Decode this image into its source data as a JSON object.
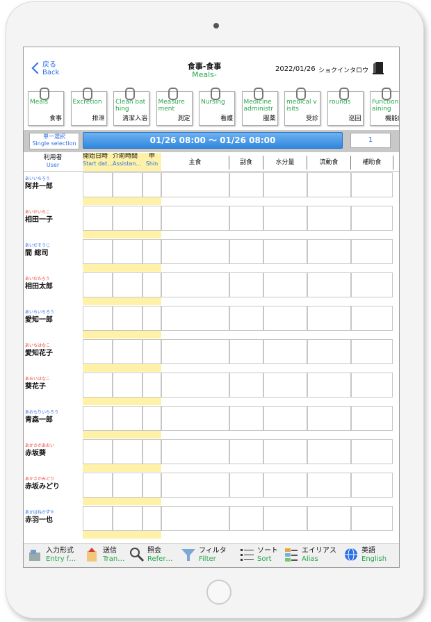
{
  "header": {
    "back_label": "戻る",
    "back_sub": "Back",
    "title": "食事-食事",
    "subtitle": "Meals-",
    "date": "2022/01/26",
    "user": "ショクインタロウ"
  },
  "tabs": [
    {
      "en": "Meals",
      "jp": "食事"
    },
    {
      "en": "Excretion",
      "jp": "排泄"
    },
    {
      "en": "Clean bathing",
      "jp": "清潔入浴"
    },
    {
      "en": "Measurement",
      "jp": "測定"
    },
    {
      "en": "Nursing",
      "jp": "看護"
    },
    {
      "en": "Medicine administra",
      "jp": "服薬"
    },
    {
      "en": "medical visits",
      "jp": "受診"
    },
    {
      "en": "rounds",
      "jp": "巡回"
    },
    {
      "en": "Function aining",
      "jp": "機能訓"
    }
  ],
  "range": {
    "select_jp": "単一選択",
    "select_en": "Single selection",
    "text": "01/26 08:00 〜 01/26 08:00",
    "page": "1"
  },
  "columns": {
    "user_jp": "利用者",
    "user_en": "User",
    "start_jp": "開始日時",
    "start_en": "Start dat…",
    "assist_jp": "介助時間",
    "assist_en": "Assistan…",
    "shin_jp": "申",
    "shin_en": "Shin",
    "main": "主食",
    "side": "副食",
    "water": "水分量",
    "liquid": "流動食",
    "supp": "補助食"
  },
  "rows": [
    {
      "kana": "あいいちろう",
      "name": "阿井一郎",
      "kana_color": "#2b6fe8"
    },
    {
      "kana": "あいだいちこ",
      "name": "相田一子",
      "kana_color": "#e8453c"
    },
    {
      "kana": "あいだそうじ",
      "name": "間 総司",
      "kana_color": "#2b6fe8"
    },
    {
      "kana": "あいだたろう",
      "name": "相田太郎",
      "kana_color": "#e8453c"
    },
    {
      "kana": "あいちいちろう",
      "name": "愛知一郎",
      "kana_color": "#2b6fe8"
    },
    {
      "kana": "あいちはなこ",
      "name": "愛知花子",
      "kana_color": "#e8453c"
    },
    {
      "kana": "あおいはなこ",
      "name": "葵花子",
      "kana_color": "#e8453c"
    },
    {
      "kana": "あおもりいちろう",
      "name": "青森一郎",
      "kana_color": "#2b6fe8"
    },
    {
      "kana": "あかさかあおい",
      "name": "赤坂葵",
      "kana_color": "#e8453c"
    },
    {
      "kana": "あかさかみどり",
      "name": "赤坂みどり",
      "kana_color": "#e8453c"
    },
    {
      "kana": "あかばねかずや",
      "name": "赤羽一也",
      "kana_color": "#2b6fe8"
    }
  ],
  "toolbar": [
    {
      "jp": "入力形式",
      "en": "Entry f…"
    },
    {
      "jp": "送信",
      "en": "Tran…"
    },
    {
      "jp": "照会",
      "en": "Refer…"
    },
    {
      "jp": "フィルタ",
      "en": "Filter"
    },
    {
      "jp": "ソート",
      "en": "Sort"
    },
    {
      "jp": "エイリアス",
      "en": "Alias"
    },
    {
      "jp": "英語",
      "en": "English"
    }
  ],
  "colors": {
    "accent_blue": "#2b6fe8",
    "accent_green": "#26a64a",
    "highlight_yellow": "#fff2a8"
  }
}
